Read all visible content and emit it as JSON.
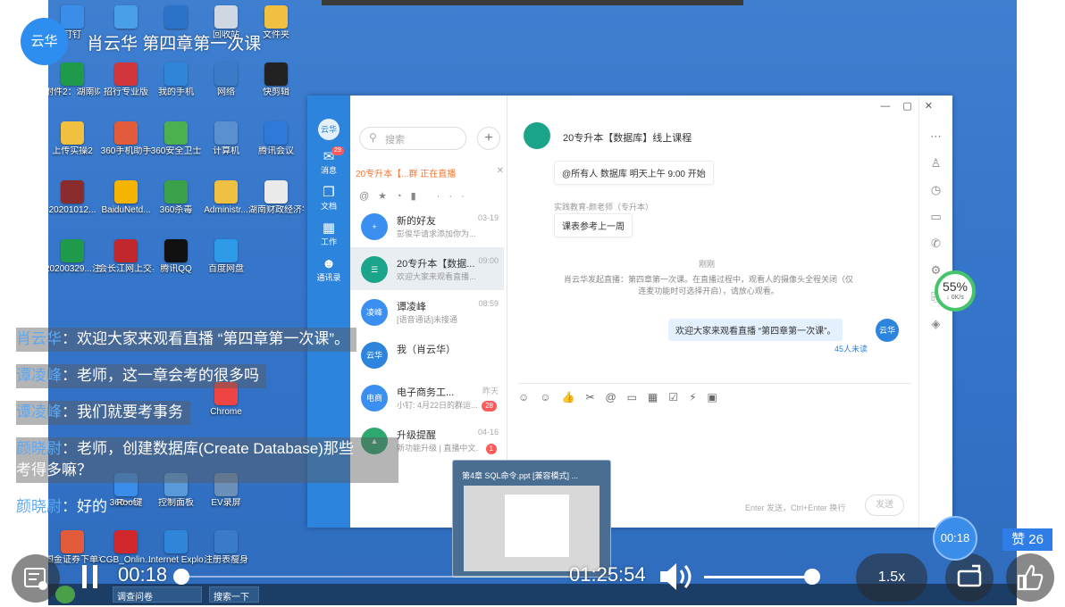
{
  "overlay": {
    "avatar_text": "云华",
    "title": "肖云华 第四章第一次课",
    "like_label": "赞 26",
    "time_bubble": "00:18"
  },
  "comments": [
    {
      "user": "肖云华",
      "text": "：欢迎大家来观看直播 “第四章第一次课”。"
    },
    {
      "user": "谭凌峰",
      "text": "：老师，这一章会考的很多吗"
    },
    {
      "user": "谭凌峰",
      "text": "：我们就要考事务"
    },
    {
      "user": "颜晓尉",
      "text": "：老师，创建数据库(Create Database)那些",
      "text2": "考得多嘛？"
    },
    {
      "user": "颜晓尉",
      "text": "：好的"
    }
  ],
  "player": {
    "current_time": "00:18",
    "total_time": "01:25:54",
    "speed": "1.5x",
    "progress": 0.002,
    "volume": 1.0
  },
  "desktop_icons": [
    {
      "label": "钉钉"
    },
    {
      "label": ""
    },
    {
      "label": ""
    },
    {
      "label": "回收站"
    },
    {
      "label": "文件夹"
    },
    {
      "label": "附件2：湖南财政经济"
    },
    {
      "label": "招行专业版"
    },
    {
      "label": "我的手机"
    },
    {
      "label": "网络"
    },
    {
      "label": "快剪辑"
    },
    {
      "label": "上传实操2"
    },
    {
      "label": "360手机助手"
    },
    {
      "label": "360安全卫士"
    },
    {
      "label": "计算机"
    },
    {
      "label": "腾讯会议"
    },
    {
      "label": "20201012..."
    },
    {
      "label": "BaiduNetd..."
    },
    {
      "label": "360杀毒"
    },
    {
      "label": "Administr..."
    },
    {
      "label": "湖南财政经济学院信"
    },
    {
      "label": "20200329...注册登录恣"
    },
    {
      "label": "会长江网上交易财智版"
    },
    {
      "label": "腾讯QQ"
    },
    {
      "label": "百度网盘"
    },
    {
      "label": "Root"
    },
    {
      "label": "控制面板"
    },
    {
      "label": "EV录屏"
    },
    {
      "label": "国金证券下单程序"
    },
    {
      "label": "CGB_Onlin..."
    },
    {
      "label": "Internet Explorer"
    },
    {
      "label": "注册表瘦身"
    },
    {
      "label": "360一键"
    },
    {
      "label": "Chrome"
    }
  ],
  "app": {
    "side_avatar": "云华",
    "nav": [
      {
        "label": "消息",
        "icon": "chat-icon",
        "badge": "29"
      },
      {
        "label": "文档",
        "icon": "doc-icon"
      },
      {
        "label": "工作",
        "icon": "grid-icon"
      },
      {
        "label": "通讯录",
        "icon": "contacts-icon"
      }
    ],
    "search_placeholder": "搜索",
    "live_banner": "20专升本【...群 正在直播",
    "conversations": [
      {
        "name": "新的好友",
        "preview": "彭俊华请求添加你为...",
        "time": "03-19",
        "avatar": "",
        "color": "#3b8ff0"
      },
      {
        "name": "20专升本【数据...",
        "preview": "欢迎大家来观看直播...",
        "time": "09:00",
        "avatar": "",
        "color": "#1aa58a"
      },
      {
        "name": "谭凌峰",
        "preview": "[语音通话]未接通",
        "time": "08:59",
        "avatar": "凌峰",
        "color": "#3b8ff0"
      },
      {
        "name": "我（肖云华）",
        "preview": "",
        "time": "",
        "avatar": "云华",
        "color": "#2c84dd"
      },
      {
        "name": "电子商务工...",
        "preview": "小钉: 4月22日的群运...",
        "time": "昨天",
        "avatar": "电商",
        "color": "#3b8ff0",
        "count": "28"
      },
      {
        "name": "升级提醒",
        "preview": "新功能升级 | 直播中文...",
        "time": "04-16",
        "avatar": "",
        "color": "#2fa870",
        "count": "1"
      }
    ],
    "chat_title": "20专升本【数据库】线上课程",
    "messages": [
      {
        "text": "@所有人  数据库 明天上午 9:00 开始"
      },
      {
        "sender": "实践教育-颜老师（专升本）",
        "text": "课表参考上一周"
      }
    ],
    "just_now": "刚刚",
    "system_msg": "肖云华发起直播：第四章第一次课。在直播过程中，观看人的摄像头全程关闭（仅连麦功能时可选择开启），请放心观看。",
    "my_msg": "欢迎大家来观看直播 “第四章第一次课”。",
    "my_avatar": "云华",
    "unread": "45人未读",
    "send_hint": "Enter 发送，Ctrl+Enter 换行",
    "send_btn": "发送"
  },
  "gauge": {
    "percent": "55%",
    "speed": "↓ 0K/s"
  },
  "thumbnail": {
    "title": "第4章 SQL命令.ppt [兼容模式] ..."
  },
  "taskbar": {
    "item1": "调查问卷",
    "item2": "搜索一下"
  }
}
